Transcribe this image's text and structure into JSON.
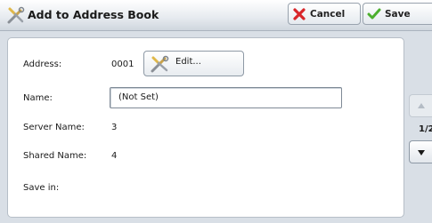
{
  "header": {
    "title": "Add to Address Book",
    "title_icon": "tools-icon",
    "cancel_label": "Cancel",
    "cancel_icon": "red-x-icon",
    "save_label": "Save",
    "save_icon": "green-check-icon"
  },
  "form": {
    "address_label": "Address:",
    "address_value": "0001",
    "edit_label": "Edit...",
    "edit_icon": "tools-icon",
    "name_label": "Name:",
    "name_value": "(Not Set)",
    "server_name_label": "Server Name:",
    "server_name_value": "3",
    "shared_name_label": "Shared Name:",
    "shared_name_value": "4",
    "save_in_label": "Save in:"
  },
  "pager": {
    "page_indicator": "1/2"
  },
  "colors": {
    "cancel_icon": "#d8262a",
    "save_icon": "#4caf2e",
    "background": "#d9dfe6"
  }
}
